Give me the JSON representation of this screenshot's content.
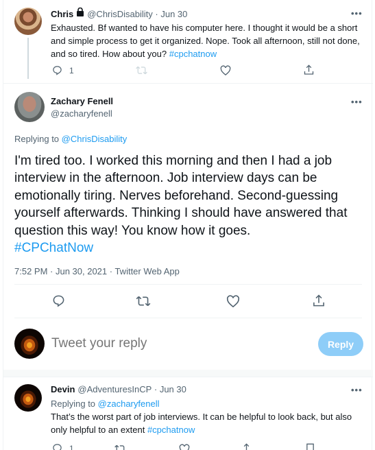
{
  "tweet1": {
    "name": "Chris",
    "handle": "@ChrisDisability",
    "date": "Jun 30",
    "text": "Exhausted. Bf wanted to have his computer here. I thought it would be a short and simple process to get it organized. Nope. Took all afternoon, still not done, and so tired. How about you?",
    "hashtag": "#cpchatnow",
    "reply_count": "1",
    "more": "•••"
  },
  "main_tweet": {
    "name": "Zachary Fenell",
    "handle": "@zacharyfenell",
    "replying_prefix": "Replying to",
    "replying_handle": "@ChrisDisability",
    "text": "I'm tired too. I worked this morning and then I had a job interview in the afternoon. Job interview days can be emotionally tiring. Nerves beforehand. Second-guessing yourself afterwards. Thinking I should have answered that question this way! You know how it goes.",
    "hashtag": "#CPChatNow",
    "timestamp": "7:52 PM · Jun 30, 2021 · Twitter Web App",
    "more": "•••"
  },
  "composer": {
    "placeholder": "Tweet your reply",
    "button": "Reply"
  },
  "tweet3": {
    "name": "Devin",
    "handle": "@AdventuresInCP",
    "date": "Jun 30",
    "replying_prefix": "Replying to",
    "replying_handle": "@zacharyfenell",
    "text": "That’s the worst part of job interviews. It can be helpful to look back, but also only helpful to an extent",
    "hashtag": "#cpchatnow",
    "reply_count": "1",
    "more": "•••"
  },
  "colors": {
    "accent": "#1d9bf0",
    "muted": "#536471",
    "reply_button_bg": "#8ecdf8",
    "divider": "#eff3f4"
  },
  "icons": [
    "reply-icon",
    "retweet-icon",
    "like-icon",
    "share-icon",
    "lock-icon",
    "more-icon",
    "bookmark-icon"
  ]
}
